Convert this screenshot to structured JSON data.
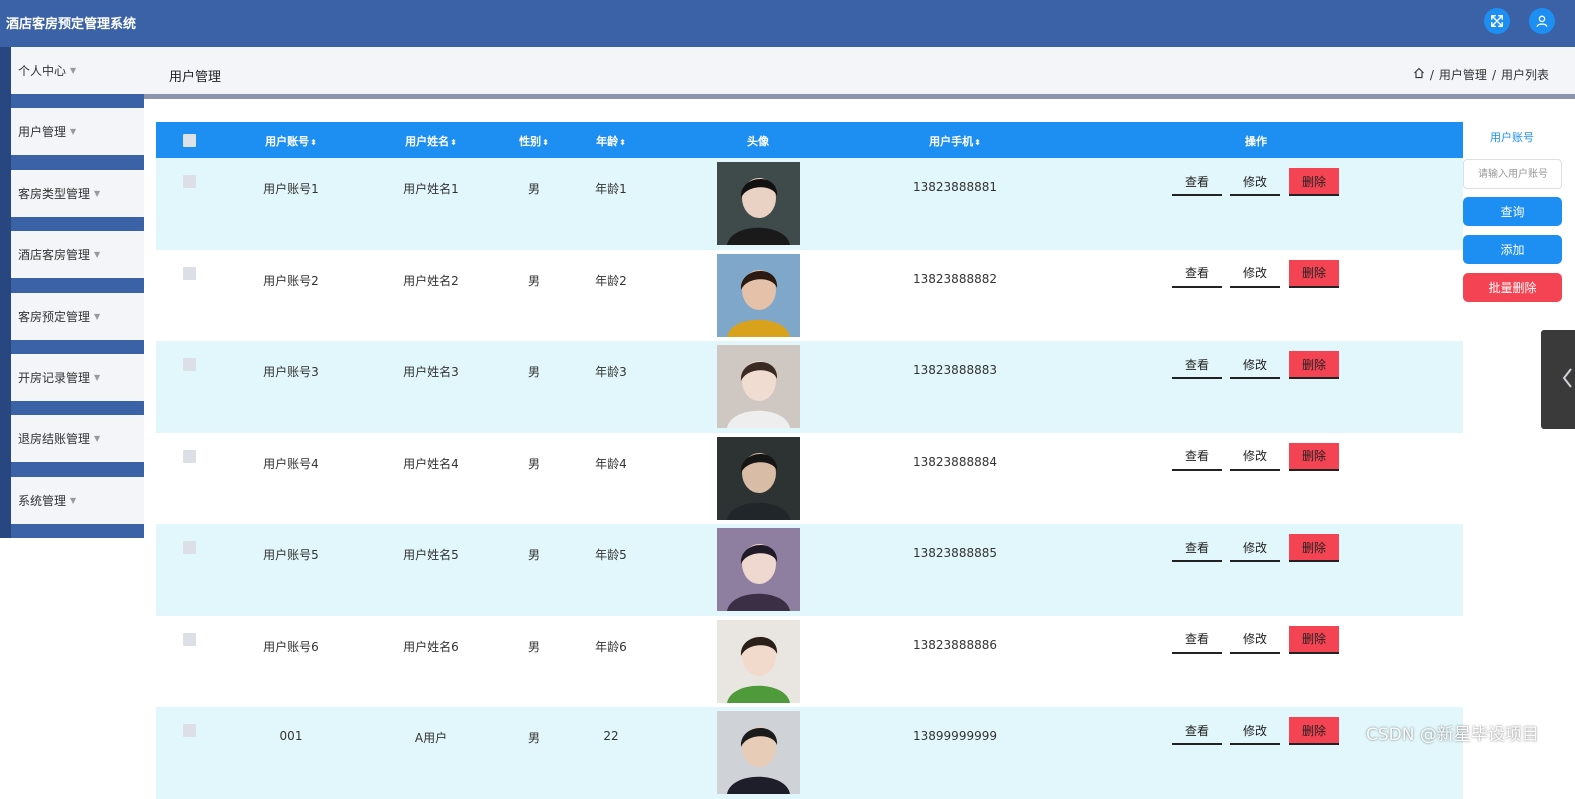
{
  "app": {
    "title": "酒店客房预定管理系统"
  },
  "header": {
    "icons": [
      "fullscreen-icon",
      "user-icon"
    ],
    "colors": {
      "bar": "#3b62a6",
      "icon_bg": "#1e8ff2"
    }
  },
  "sidebar": {
    "items": [
      {
        "label": "个人中心"
      },
      {
        "label": "用户管理"
      },
      {
        "label": "客房类型管理"
      },
      {
        "label": "酒店客房管理"
      },
      {
        "label": "客房预定管理"
      },
      {
        "label": "开房记录管理"
      },
      {
        "label": "退房结账管理"
      },
      {
        "label": "系统管理"
      }
    ],
    "caret": "▼"
  },
  "page": {
    "title": "用户管理",
    "breadcrumb": {
      "home_icon": "home-icon",
      "sep1": "/",
      "item1": "用户管理",
      "sep2": "/",
      "item2": "用户列表"
    }
  },
  "table": {
    "headers": {
      "account": "用户账号",
      "name": "用户姓名",
      "gender": "性别",
      "age": "年龄",
      "avatar": "头像",
      "phone": "用户手机",
      "actions": "操作"
    },
    "sort_glyph": "⬍",
    "actions": {
      "view": "查看",
      "edit": "修改",
      "delete": "删除"
    },
    "rows": [
      {
        "account": "用户账号1",
        "name": "用户姓名1",
        "gender": "男",
        "age": "年龄1",
        "phone": "13823888881"
      },
      {
        "account": "用户账号2",
        "name": "用户姓名2",
        "gender": "男",
        "age": "年龄2",
        "phone": "13823888882"
      },
      {
        "account": "用户账号3",
        "name": "用户姓名3",
        "gender": "男",
        "age": "年龄3",
        "phone": "13823888883"
      },
      {
        "account": "用户账号4",
        "name": "用户姓名4",
        "gender": "男",
        "age": "年龄4",
        "phone": "13823888884"
      },
      {
        "account": "用户账号5",
        "name": "用户姓名5",
        "gender": "男",
        "age": "年龄5",
        "phone": "13823888885"
      },
      {
        "account": "用户账号6",
        "name": "用户姓名6",
        "gender": "男",
        "age": "年龄6",
        "phone": "13823888886"
      },
      {
        "account": "001",
        "name": "A用户",
        "gender": "男",
        "age": "22",
        "phone": "13899999999"
      }
    ],
    "colors": {
      "header": "#1e8ff2",
      "row_alt": "#e2f7fb",
      "delete": "#f44454"
    }
  },
  "search": {
    "label": "用户账号",
    "placeholder": "请输入用户账号",
    "query_label": "查询",
    "add_label": "添加",
    "batch_delete_label": "批量删除"
  },
  "watermark": "CSDN @新星毕设项目"
}
